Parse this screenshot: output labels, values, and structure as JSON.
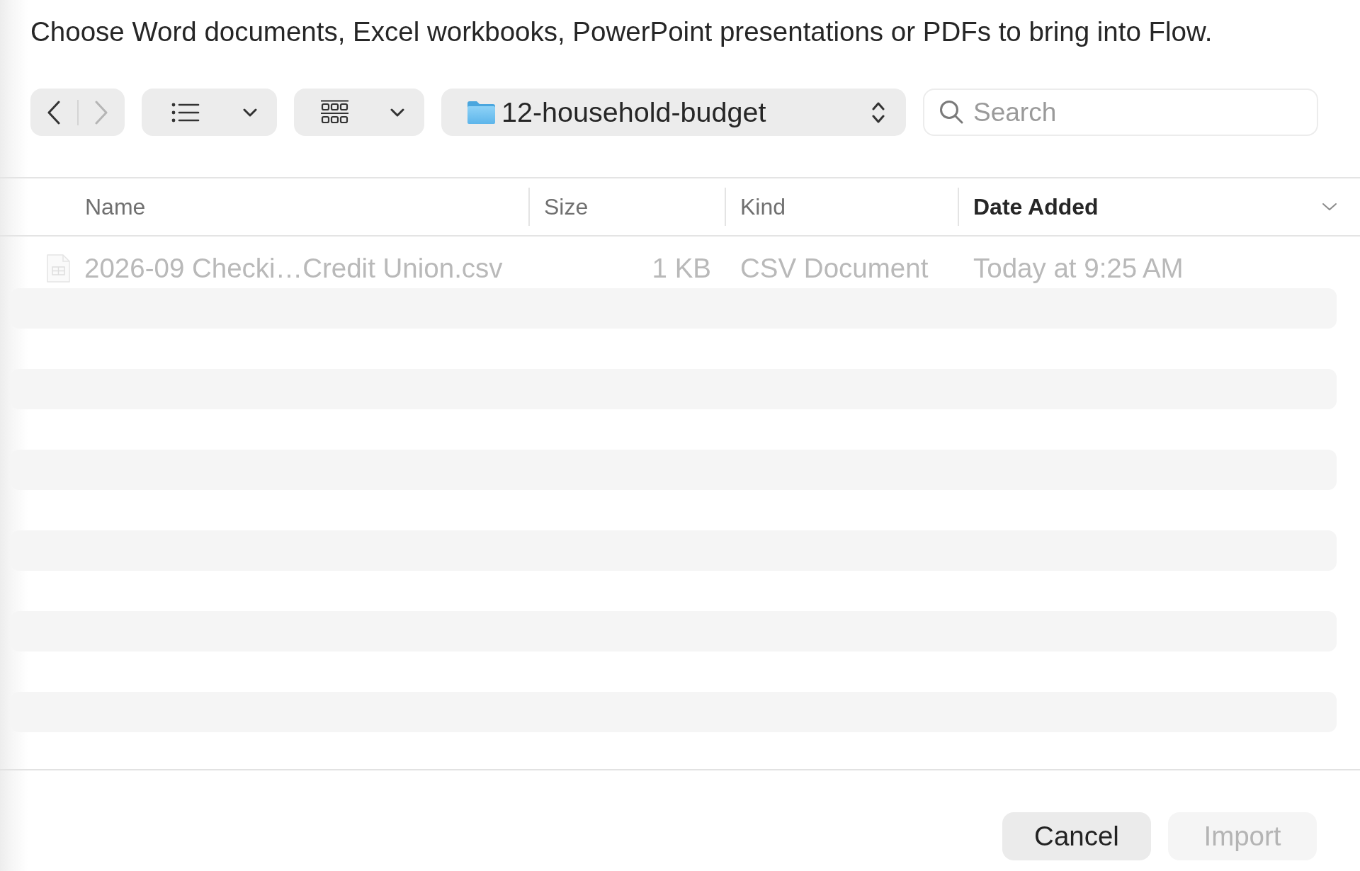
{
  "prompt": "Choose Word documents, Excel workbooks, PowerPoint presentations or PDFs to bring into Flow.",
  "toolbar": {
    "navigation": [
      {
        "kind": "back",
        "disabled": false
      },
      {
        "kind": "forward",
        "disabled": true
      }
    ],
    "location": "12-household-budget",
    "search": {
      "placeholder": "Search"
    }
  },
  "table": {
    "columns": [
      {
        "label": "Name",
        "sorted": false
      },
      {
        "label": "Size",
        "sorted": false
      },
      {
        "label": "Kind",
        "sorted": false
      },
      {
        "label": "Date Added",
        "sorted": true
      }
    ],
    "rows": [
      {
        "name": "2026-09 Checki…Credit Union.csv",
        "size": "1 KB",
        "file_kind": "CSV Document",
        "date_added": "Today at 9:25 AM",
        "disabled": true
      }
    ]
  },
  "buttons": [
    {
      "label": "Cancel",
      "disabled": false
    },
    {
      "label": "Import",
      "disabled": true
    }
  ]
}
